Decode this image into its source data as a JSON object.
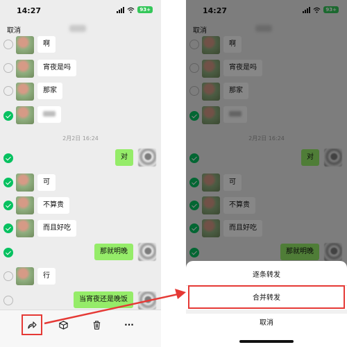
{
  "status": {
    "time": "14:27",
    "battery": "93+"
  },
  "nav": {
    "cancel": "取消"
  },
  "date_separator": "2月2日 16:24",
  "messages": [
    {
      "text": "啊"
    },
    {
      "text": "宵夜是吗"
    },
    {
      "text": "那家"
    },
    {
      "text": ""
    },
    {
      "text": "对"
    },
    {
      "text": "可"
    },
    {
      "text": "不算贵"
    },
    {
      "text": "而且好吃"
    },
    {
      "text": "那就明晚"
    },
    {
      "text": "行"
    },
    {
      "text": "当宵夜还是晚饭"
    }
  ],
  "toolbar": {
    "forward_icon": "forward-icon",
    "favorite_icon": "cube-icon",
    "delete_icon": "trash-icon",
    "more_label": "···"
  },
  "sheet": {
    "one_by_one": "逐条转发",
    "merge": "合并转发",
    "cancel": "取消"
  },
  "colors": {
    "accent_green": "#07c160",
    "bubble_green": "#95ec69",
    "highlight_red": "#e53935"
  }
}
